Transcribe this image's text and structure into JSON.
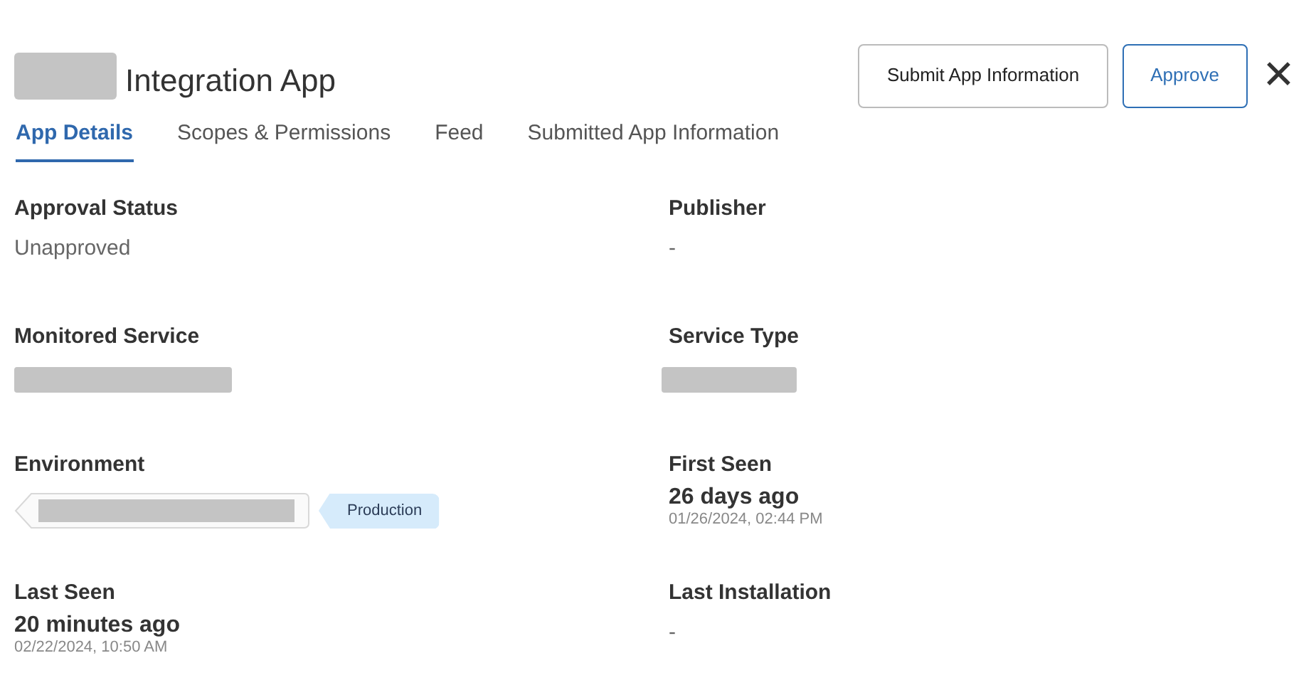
{
  "header": {
    "title": "Integration App",
    "title_redacted": true,
    "buttons": [
      {
        "label": "Submit App Information",
        "kind": "secondary"
      },
      {
        "label": "Approve",
        "kind": "primary"
      }
    ],
    "close": "✕"
  },
  "tabs": [
    {
      "label": "App Details",
      "selected": true
    },
    {
      "label": "Scopes & Permissions",
      "selected": false
    },
    {
      "label": "Feed",
      "selected": false
    },
    {
      "label": "Submitted App Information",
      "selected": false
    }
  ],
  "fields": [
    {
      "label": "Approval Status",
      "kind": "text",
      "value": "Unapproved"
    },
    {
      "label": "Publisher",
      "kind": "text",
      "value": "-"
    },
    {
      "label": "Monitored Service",
      "kind": "redacted"
    },
    {
      "label": "Service Type",
      "kind": "redacted"
    },
    {
      "label": "Environment",
      "kind": "tags",
      "tag": "Production"
    },
    {
      "label": "First Seen",
      "kind": "time",
      "value": "26 days ago",
      "detail": "01/26/2024, 02:44 PM"
    },
    {
      "label": "Last Seen",
      "kind": "time",
      "value": "20 minutes ago",
      "detail": "02/22/2024, 10:50 AM"
    },
    {
      "label": "Last Installation",
      "kind": "text",
      "value": "-"
    }
  ]
}
